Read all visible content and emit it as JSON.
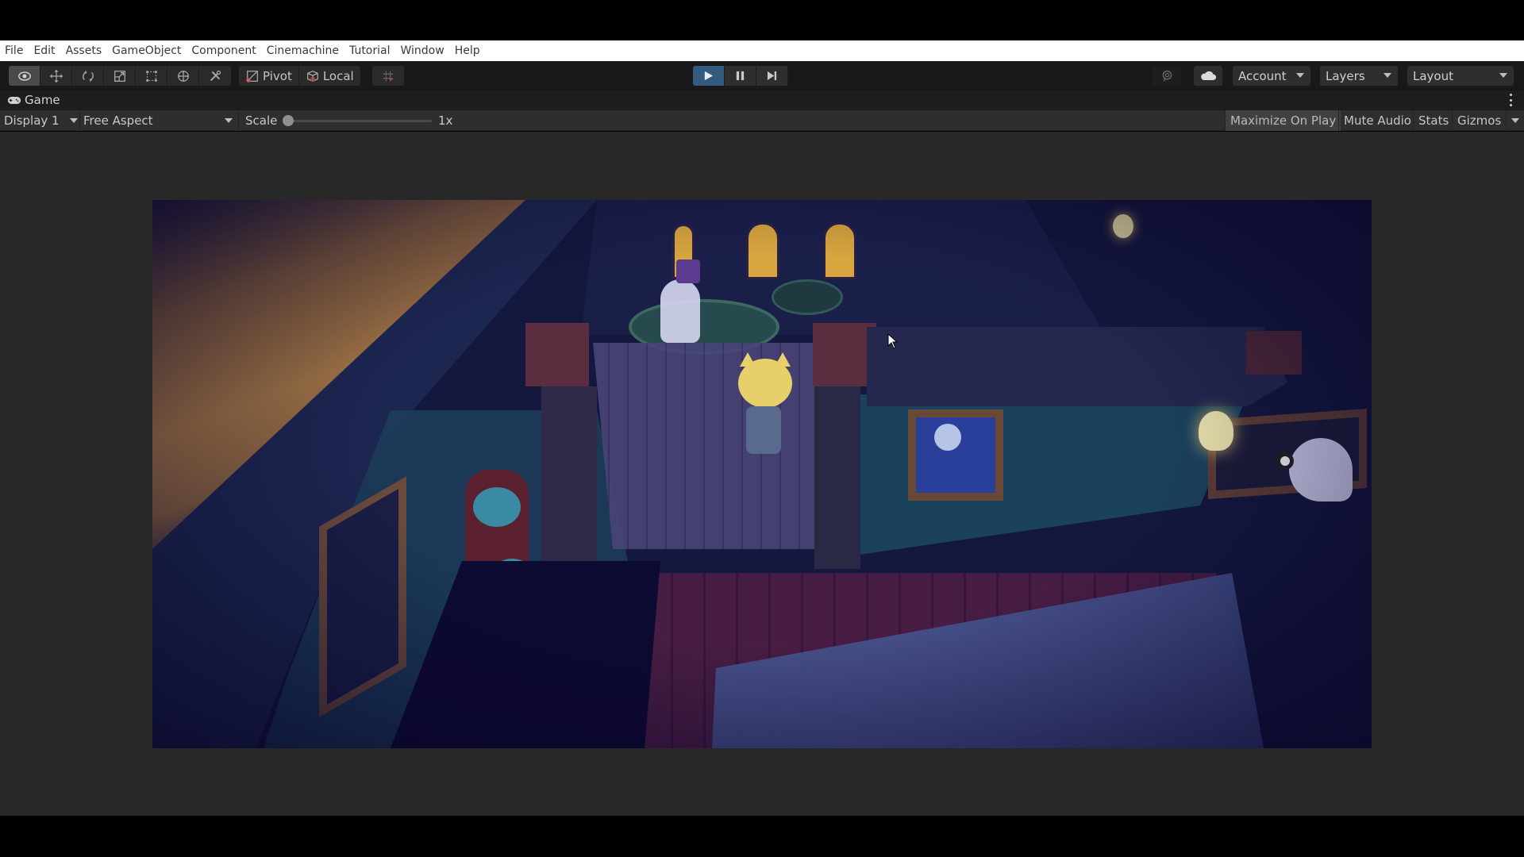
{
  "menu": {
    "items": [
      "File",
      "Edit",
      "Assets",
      "GameObject",
      "Component",
      "Cinemachine",
      "Tutorial",
      "Window",
      "Help"
    ]
  },
  "toolbar": {
    "tools": [
      {
        "name": "view-tool",
        "icon": "eye-icon",
        "active": true
      },
      {
        "name": "move-tool",
        "icon": "move-arrows-icon",
        "active": false
      },
      {
        "name": "rotate-tool",
        "icon": "rotate-icon",
        "active": false
      },
      {
        "name": "scale-tool",
        "icon": "scale-icon",
        "active": false
      },
      {
        "name": "rect-tool",
        "icon": "rect-transform-icon",
        "active": false
      },
      {
        "name": "transform-tool",
        "icon": "transform-icon",
        "active": false
      },
      {
        "name": "custom-tool",
        "icon": "tools-icon",
        "active": false
      }
    ],
    "pivot_label": "Pivot",
    "local_label": "Local",
    "grid_snap_icon": "grid-snap-icon",
    "playback": {
      "play_active": true,
      "pause_active": false
    },
    "collab_icon": "collab-icon",
    "cloud_icon": "cloud-icon",
    "account_label": "Account",
    "layers_label": "Layers",
    "layout_label": "Layout"
  },
  "game_panel": {
    "tab_label": "Game",
    "tab_icon": "gamepad-icon",
    "display_label": "Display 1",
    "aspect_label": "Free Aspect",
    "scale_label": "Scale",
    "scale_value": "1x",
    "scale_fraction": 0.0,
    "toggles": [
      {
        "label": "Maximize On Play",
        "on": true
      },
      {
        "label": "Mute Audio",
        "on": false
      },
      {
        "label": "Stats",
        "on": false
      },
      {
        "label": "Gizmos",
        "on": false
      }
    ]
  },
  "colors": {
    "play_active": "#335a7f",
    "menubar_bg": "#ffffff",
    "toolbar_bg": "#191919",
    "editor_bg": "#282828"
  }
}
